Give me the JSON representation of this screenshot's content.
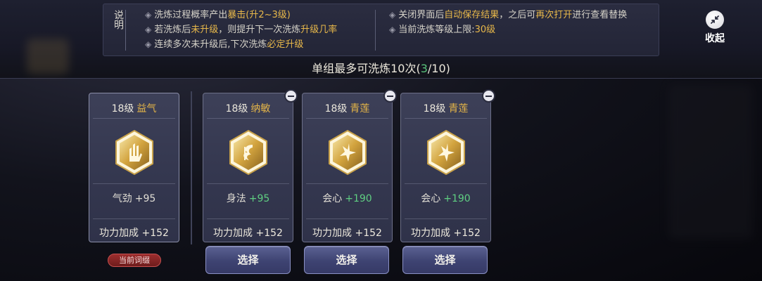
{
  "info_panel": {
    "side_label": "说明",
    "left_lines": [
      {
        "prefix": "洗炼过程概率产出",
        "highlight": "暴击(升2~3级)",
        "suffix": ""
      },
      {
        "prefix": "若洗炼后",
        "highlight": "未升级",
        "mid": "，则提升下一次洗炼",
        "highlight2": "升级几率"
      },
      {
        "prefix": "连续多次未升级后,下次洗炼",
        "highlight": "必定升级",
        "suffix": ""
      }
    ],
    "right_lines": [
      {
        "prefix": "关闭界面后",
        "highlight": "自动保存结果",
        "mid": "，之后可",
        "highlight2": "再次打开",
        "suffix": "进行查看替换"
      },
      {
        "prefix": "当前洗炼等级上限:",
        "highlight": "30级",
        "suffix": ""
      }
    ]
  },
  "collapse": {
    "label": "收起",
    "icon": "collapse-arrows-icon"
  },
  "headline": {
    "text": "单组最多可洗炼10次(",
    "count": "3",
    "total": "/10)"
  },
  "cards": [
    {
      "level": "18级",
      "name": "益气",
      "emblem": "palm-icon",
      "stat_name": "气劲",
      "stat_value": "+95",
      "stat_color": "white",
      "power_label": "功力加成",
      "power_value": "+152",
      "current": true
    },
    {
      "level": "18级",
      "name": "纳敏",
      "emblem": "swirl-icon",
      "stat_name": "身法",
      "stat_value": "+95",
      "stat_color": "green",
      "power_label": "功力加成",
      "power_value": "+152",
      "current": false
    },
    {
      "level": "18级",
      "name": "青莲",
      "emblem": "lotus-star-icon",
      "stat_name": "会心",
      "stat_value": "+190",
      "stat_color": "green",
      "power_label": "功力加成",
      "power_value": "+152",
      "current": false
    },
    {
      "level": "18级",
      "name": "青莲",
      "emblem": "lotus-star-icon",
      "stat_name": "会心",
      "stat_value": "+190",
      "stat_color": "green",
      "power_label": "功力加成",
      "power_value": "+152",
      "current": false
    }
  ],
  "current_tag": "当前词缀",
  "select_label": "选择",
  "colors": {
    "gold": "#e6b648",
    "green": "#5fcf82",
    "red_tag": "#9c2e2e"
  }
}
